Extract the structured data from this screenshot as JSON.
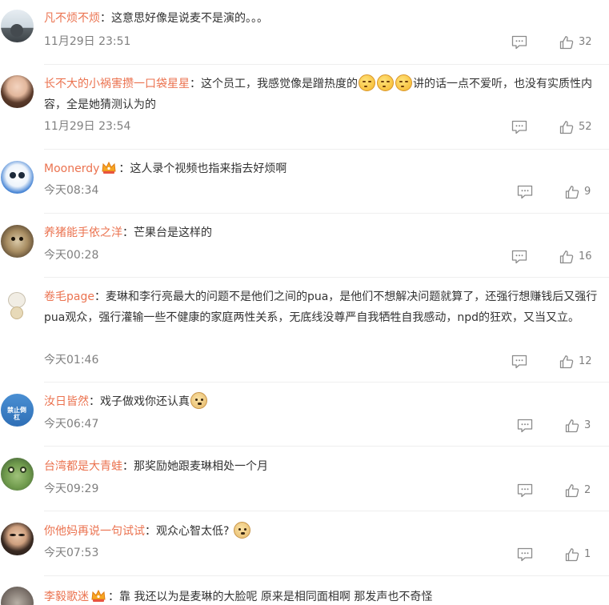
{
  "comments": [
    {
      "name": "凡不烦不烦",
      "text": "这意思好像是说麦不是演的。。。",
      "time": "11月29日 23:51",
      "likes": "32"
    },
    {
      "name": "长不大的小祸害攒一口袋星星",
      "text_a": "这个员工，我感觉像是蹭热度的",
      "text_b": "讲的话一点不爱听，也没有实质性内容，全是她猜测认为的",
      "time": "11月29日 23:54",
      "likes": "52"
    },
    {
      "name": "Moonerdy",
      "text": "这人录个视频也指来指去好烦啊",
      "time": "今天08:34",
      "likes": "9"
    },
    {
      "name": "养猪能手依之洋",
      "text": "芒果台是这样的",
      "time": "今天00:28",
      "likes": "16"
    },
    {
      "name": "卷毛page",
      "text": "麦琳和李行亮最大的问题不是他们之间的pua，是他们不想解决问题就算了，还强行想赚钱后又强行pua观众，强行灌输一些不健康的家庭两性关系，无底线没尊严自我牺牲自我感动，npd的狂欢，又当又立。",
      "time": "今天01:46",
      "likes": "12"
    },
    {
      "name": "汝日皆然",
      "text": "戏子做戏你还认真",
      "time": "今天06:47",
      "likes": "3",
      "avatar_text": "禁止倒杠"
    },
    {
      "name": "台湾都是大青蛙",
      "text": "那奖励她跟麦琳相处一个月",
      "time": "今天09:29",
      "likes": "2"
    },
    {
      "name": "你他妈再说一句试试",
      "text": "观众心智太低?",
      "time": "今天07:53",
      "likes": "1"
    },
    {
      "name": "李毅歌迷",
      "text": "靠 我还以为是麦琳的大脸呢 原来是相同面相啊 那发声也不奇怪"
    }
  ],
  "colon": "：",
  "icons": {
    "reply": "comment-icon",
    "like": "thumbs-up-icon",
    "badge": "vip-crown-icon"
  },
  "colors": {
    "username": "#eb7350",
    "meta": "#808080",
    "text": "#333333"
  }
}
